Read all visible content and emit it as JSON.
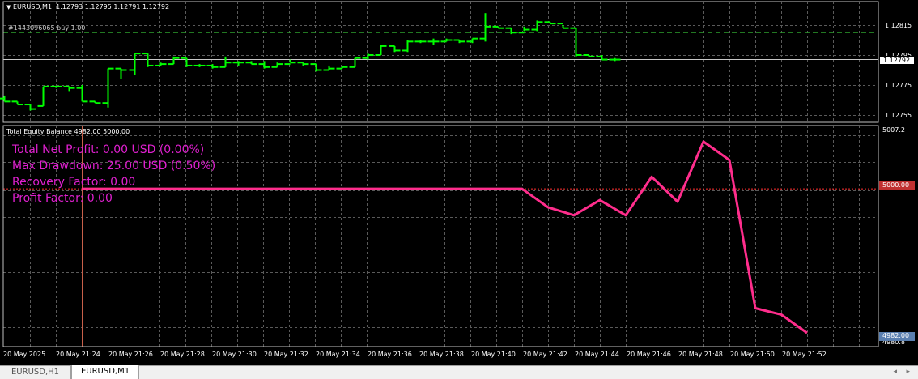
{
  "window": {
    "symbol_title": "EURUSD,M1",
    "ohlc": "1.12793 1.12795 1.12791 1.12792",
    "order_line": "#1443096065 buy 1.00"
  },
  "price_axis": {
    "labels": [
      "1.12815",
      "1.12795",
      "1.12775",
      "1.12755"
    ],
    "current_price": "1.12792"
  },
  "indicator": {
    "header": "Total Equity Balance 4982.00 5000.00",
    "axis_top": "5007.2",
    "axis_bottom": "4980.8",
    "balance_label": "5000.00",
    "equity_label": "4982.00",
    "stats": {
      "net_profit": "Total Net Profit: 0.00 USD (0.00%)",
      "max_drawdown": "Max Drawdown: 25.00 USD (0.50%)",
      "recovery_factor": "Recovery Factor: 0.00",
      "profit_factor": "Profit Factor: 0.00"
    }
  },
  "time_axis": [
    "20 May 2025",
    "20 May 21:24",
    "20 May 21:26",
    "20 May 21:28",
    "20 May 21:30",
    "20 May 21:32",
    "20 May 21:34",
    "20 May 21:36",
    "20 May 21:38",
    "20 May 21:40",
    "20 May 21:42",
    "20 May 21:44",
    "20 May 21:46",
    "20 May 21:48",
    "20 May 21:50",
    "20 May 21:52"
  ],
  "tabs": [
    {
      "label": "EURUSD,H1",
      "active": false
    },
    {
      "label": "EURUSD,M1",
      "active": true
    }
  ],
  "colors": {
    "background": "#000000",
    "bar": "#00ff00",
    "equity_line": "#ff2d8c",
    "stats_text": "#e020d0",
    "balance_line": "#ff3030",
    "grid": "#5a5a5a"
  },
  "chart_data": [
    {
      "type": "bar",
      "title": "EURUSD,M1",
      "xlabel": "",
      "ylabel": "",
      "ylim": [
        1.12745,
        1.12825
      ],
      "bars": [
        [
          1.12766,
          1.12768,
          1.12764,
          1.12764
        ],
        [
          1.12764,
          1.12764,
          1.12762,
          1.12762
        ],
        [
          1.12762,
          1.12762,
          1.12758,
          1.12759
        ],
        [
          1.12761,
          1.12774,
          1.12761,
          1.12774
        ],
        [
          1.12774,
          1.12774,
          1.12773,
          1.12774
        ],
        [
          1.12774,
          1.12774,
          1.12771,
          1.12773
        ],
        [
          1.12773,
          1.12775,
          1.12764,
          1.12764
        ],
        [
          1.12764,
          1.12764,
          1.12763,
          1.12763
        ],
        [
          1.12763,
          1.12786,
          1.1276,
          1.12786
        ],
        [
          1.12786,
          1.12786,
          1.12779,
          1.12785
        ],
        [
          1.12785,
          1.12796,
          1.12782,
          1.12796
        ],
        [
          1.12796,
          1.12796,
          1.12787,
          1.12788
        ],
        [
          1.12788,
          1.1279,
          1.12788,
          1.12789
        ],
        [
          1.12789,
          1.12794,
          1.12789,
          1.12793
        ],
        [
          1.12793,
          1.12793,
          1.12787,
          1.12788
        ],
        [
          1.12788,
          1.12789,
          1.12787,
          1.12788
        ],
        [
          1.12788,
          1.12789,
          1.12786,
          1.12787
        ],
        [
          1.12787,
          1.12794,
          1.12787,
          1.1279
        ],
        [
          1.1279,
          1.12791,
          1.12788,
          1.1279
        ],
        [
          1.1279,
          1.12791,
          1.12789,
          1.12789
        ],
        [
          1.12789,
          1.12791,
          1.12786,
          1.12787
        ],
        [
          1.12787,
          1.1279,
          1.12787,
          1.12789
        ],
        [
          1.12789,
          1.12792,
          1.1279,
          1.1279
        ],
        [
          1.1279,
          1.1279,
          1.12788,
          1.12789
        ],
        [
          1.12789,
          1.12789,
          1.12784,
          1.12785
        ],
        [
          1.12785,
          1.12788,
          1.12785,
          1.12786
        ],
        [
          1.12786,
          1.12787,
          1.12786,
          1.12787
        ],
        [
          1.12787,
          1.12793,
          1.12787,
          1.12793
        ],
        [
          1.12793,
          1.12796,
          1.12792,
          1.12795
        ],
        [
          1.12795,
          1.12802,
          1.12795,
          1.12801
        ],
        [
          1.12801,
          1.12801,
          1.12797,
          1.12798
        ],
        [
          1.12798,
          1.12805,
          1.12797,
          1.12804
        ],
        [
          1.12804,
          1.12805,
          1.12803,
          1.12804
        ],
        [
          1.12804,
          1.12806,
          1.12802,
          1.12804
        ],
        [
          1.12804,
          1.12806,
          1.12804,
          1.12805
        ],
        [
          1.12805,
          1.12805,
          1.12803,
          1.12804
        ],
        [
          1.12804,
          1.12806,
          1.12803,
          1.12806
        ],
        [
          1.12806,
          1.12823,
          1.12804,
          1.12814
        ],
        [
          1.12814,
          1.12814,
          1.12813,
          1.12813
        ],
        [
          1.12813,
          1.12813,
          1.12809,
          1.1281
        ],
        [
          1.1281,
          1.12814,
          1.12811,
          1.12812
        ],
        [
          1.12812,
          1.12818,
          1.12811,
          1.12817
        ],
        [
          1.12817,
          1.12817,
          1.12816,
          1.12816
        ],
        [
          1.12816,
          1.12815,
          1.12813,
          1.12813
        ],
        [
          1.12813,
          1.12813,
          1.12794,
          1.12795
        ],
        [
          1.12795,
          1.12795,
          1.12794,
          1.12794
        ],
        [
          1.12794,
          1.12795,
          1.12792,
          1.12792
        ],
        [
          1.12792,
          1.12793,
          1.12791,
          1.12792
        ]
      ]
    },
    {
      "type": "line",
      "title": "Total Equity Balance",
      "xlabel": "",
      "ylabel": "",
      "ylim": [
        4980.8,
        5007.2
      ],
      "series": [
        {
          "name": "Equity",
          "values": [
            5000.0,
            5000.0,
            5000.0,
            5000.0,
            5000.0,
            5000.0,
            5000.0,
            5000.0,
            5000.0,
            5000.0,
            5000.0,
            5000.0,
            5000.0,
            5000.0,
            5000.0,
            5000.0,
            5000.0,
            5000.0,
            5000.0,
            5000.0,
            5000.0,
            4997.7,
            4996.7,
            4998.6,
            4996.7,
            5001.5,
            4998.4,
            5005.9,
            5003.6,
            4985.1,
            4984.3,
            4982.0
          ]
        }
      ],
      "balance": 5000.0
    }
  ]
}
